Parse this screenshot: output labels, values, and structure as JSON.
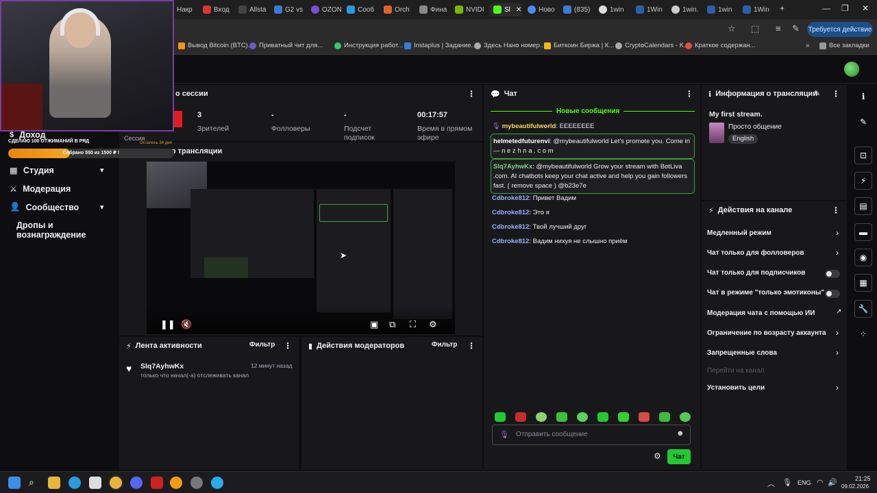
{
  "browser": {
    "tabs": [
      "Накр",
      "Вход",
      "Allsta",
      "G2 vs",
      "OZON",
      "Сооб",
      "Orch",
      "Фина",
      "NVIDI",
      "Sl",
      "Ново",
      "(835)",
      "1win",
      "1Win",
      "1win.",
      "1win",
      "1Win"
    ],
    "signin_label": "Требуется действие",
    "bookmarks": [
      "Вывод Bitcoin (BTC)...",
      "Приватный чит для...",
      "Инструкция работ...",
      "Instaplus | Задание...",
      "Здесь Нано номер...",
      "Биткоин Биржа | К...",
      "CryptoCalendars - K...",
      "Краткое содержан..."
    ],
    "all_bookmarks": "Все закладки"
  },
  "overlay": {
    "goal_title": "СДЕЛАЮ 100 ОТЖИМАНИЙ В РЯД",
    "goal_progress": "Собрано 550  из 1500 ₽ !",
    "goal_fraction": 0.37,
    "remaining": "Осталось 34 дня"
  },
  "nav": {
    "income": "Доход",
    "studio": "Студия",
    "moderation": "Модерация",
    "community": "Сообщество",
    "drops": "Дропы и вознаграждение"
  },
  "session": {
    "title": "о сессии",
    "prefix": "Сессия",
    "stats": [
      {
        "value": "3",
        "label": "Зрителей"
      },
      {
        "value": "-",
        "label": "Фолловеры"
      },
      {
        "value": "-",
        "label": "Подсчет подписок"
      },
      {
        "value": "00:17:57",
        "label": "Время в прямом эфире"
      }
    ]
  },
  "preview": {
    "title": "отр трансляции"
  },
  "activity": {
    "title": "Лента активности",
    "filter": "Фильтр",
    "items": [
      {
        "user": "Slq7AyhwKx",
        "time": "12 минут назад",
        "text": "только что начал(-а) отслеживать канал"
      }
    ]
  },
  "mod_actions": {
    "title": "Действия модераторов",
    "filter": "Фильтр"
  },
  "chat": {
    "title": "Чат",
    "new_messages": "Новые сообщения",
    "messages": [
      {
        "user": "mybeautifulworld",
        "text": "EEEEEEEE",
        "color": "#ffd84d"
      },
      {
        "user": "helmetedfuturenvi",
        "text": "@mybeautifulworld Let's promote you. Come in — n e z h n a . c o m",
        "color": "#ffffff"
      },
      {
        "user": "Slq7AyhwKx",
        "text": "@mybeautifulworld Grow your stream with BotLiva .com. AI chatbots keep your chat active and help you gain followers fast. ( remove space ) @b23e7e",
        "color": "#7dd87d"
      },
      {
        "user": "Cdbroke812",
        "text": "Привет Вадим",
        "color": "#8fb4ff"
      },
      {
        "user": "Cdbroke812",
        "text": "Это я",
        "color": "#8fb4ff"
      },
      {
        "user": "Cdbroke812",
        "text": "Твой лучший друг",
        "color": "#8fb4ff"
      },
      {
        "user": "Cdbroke812",
        "text": "Вадим нихуя не слышно приём",
        "color": "#8fb4ff"
      }
    ],
    "input_placeholder": "Отправить сообщение",
    "send_label": "Чат"
  },
  "stream_info": {
    "title": "Информация о трансляции",
    "stream_title": "My first stream.",
    "category": "Просто общение",
    "language": "English"
  },
  "channel_actions": {
    "title": "Действия на канале",
    "items": [
      {
        "label": "Медленный режим",
        "control": "arrow"
      },
      {
        "label": "Чат только для фолловеров",
        "control": "arrow"
      },
      {
        "label": "Чат только для подписчиков",
        "control": "toggle"
      },
      {
        "label": "Чат в режиме \"только эмотиконы\"",
        "control": "toggle"
      },
      {
        "label": "Модерация чата с помощью ИИ",
        "control": "external"
      },
      {
        "label": "Ограничение по возрасту аккаунта",
        "control": "arrow"
      },
      {
        "label": "Запрещенные слова",
        "control": "arrow"
      },
      {
        "label": "Перейти на канал",
        "control": "none"
      },
      {
        "label": "Установить цели",
        "control": "arrow"
      }
    ]
  },
  "taskbar": {
    "lang": "ENG",
    "time": "21:25",
    "date": "09.02.2026"
  },
  "colors": {
    "accent": "#53fc18",
    "background": "#0e0e10",
    "panel": "#18181b"
  }
}
